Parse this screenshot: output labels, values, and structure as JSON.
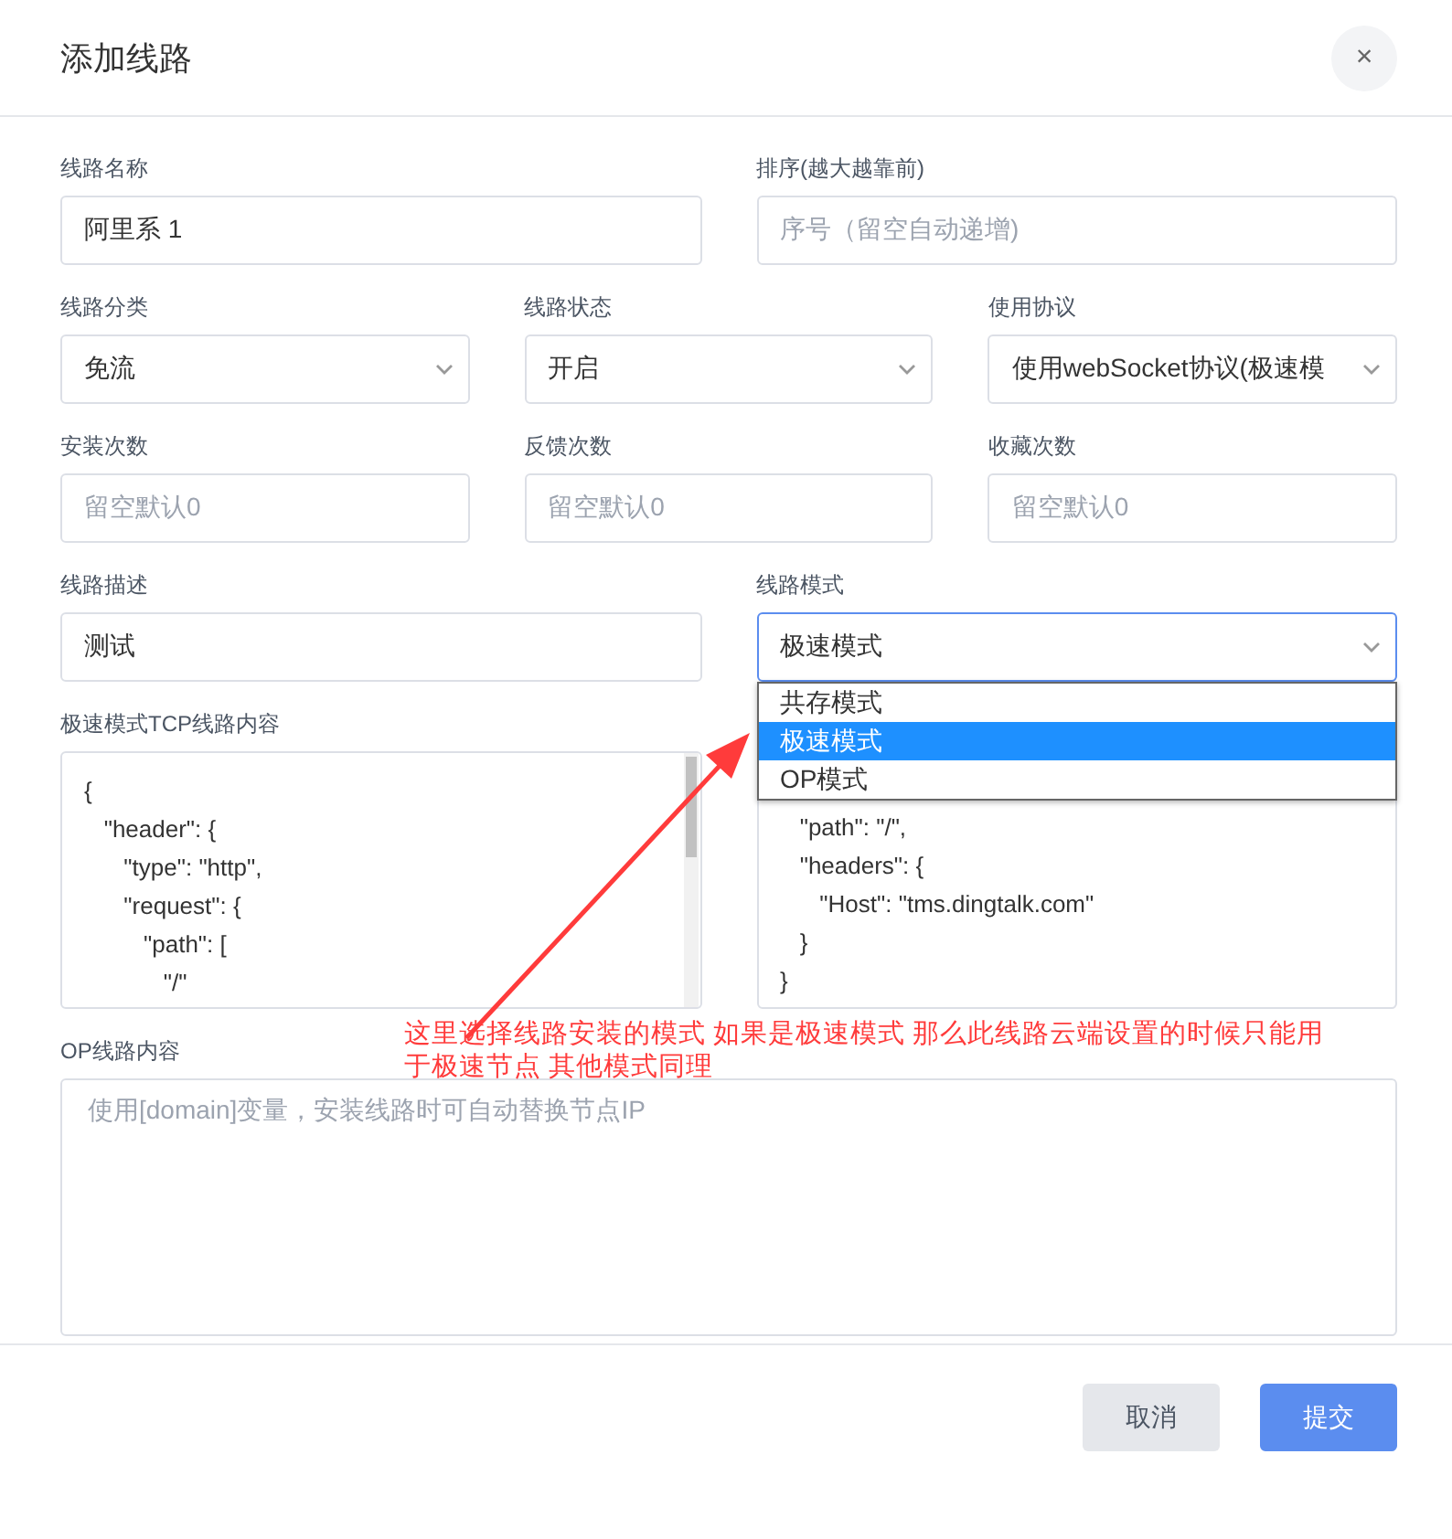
{
  "dialog": {
    "title": "添加线路",
    "close": "×"
  },
  "rows": [
    {
      "fields": [
        {
          "kind": "input",
          "label": "线路名称",
          "value": "阿里系 1"
        },
        {
          "kind": "input",
          "label": "排序(越大越靠前)",
          "placeholder": "序号（留空自动递增)"
        }
      ]
    },
    {
      "fields": [
        {
          "kind": "select",
          "label": "线路分类",
          "value": "免流"
        },
        {
          "kind": "select",
          "label": "线路状态",
          "value": "开启"
        },
        {
          "kind": "select",
          "label": "使用协议",
          "value": "使用webSocket协议(极速模"
        }
      ]
    },
    {
      "fields": [
        {
          "kind": "input",
          "label": "安装次数",
          "placeholder": "留空默认0"
        },
        {
          "kind": "input",
          "label": "反馈次数",
          "placeholder": "留空默认0"
        },
        {
          "kind": "input",
          "label": "收藏次数",
          "placeholder": "留空默认0"
        }
      ]
    },
    {
      "fields": [
        {
          "kind": "input",
          "label": "线路描述",
          "value": "测试"
        },
        {
          "kind": "select",
          "label": "线路模式",
          "value": "极速模式",
          "focused": true,
          "options": [
            {
              "label": "共存模式",
              "selected": false
            },
            {
              "label": "极速模式",
              "selected": true
            },
            {
              "label": "OP模式",
              "selected": false
            }
          ]
        }
      ]
    },
    {
      "fields": [
        {
          "kind": "code",
          "label": "极速模式TCP线路内容",
          "scrollbar": true,
          "lines": [
            "{",
            "   \"header\": {",
            "      \"type\": \"http\",",
            "      \"request\": {",
            "         \"path\": [",
            "            \"/\""
          ]
        },
        {
          "kind": "code",
          "scrollbar": false,
          "lines": [
            "   \"path\": \"/\",",
            "   \"headers\": {",
            "      \"Host\": \"tms.dingtalk.com\"",
            "   }",
            "}"
          ]
        }
      ]
    },
    {
      "fields": [
        {
          "kind": "textarea",
          "label": "OP线路内容",
          "placeholder": "使用[domain]变量，安装线路时可自动替换节点IP"
        }
      ]
    }
  ],
  "annotation": {
    "text": "这里选择线路安装的模式 如果是极速模式 那么此线路云端设置的时候只能用于极速节点 其他模式同理",
    "color": "#ff3b3b"
  },
  "buttons": [
    {
      "label": "取消",
      "kind": "secondary"
    },
    {
      "label": "提交",
      "kind": "primary"
    }
  ]
}
